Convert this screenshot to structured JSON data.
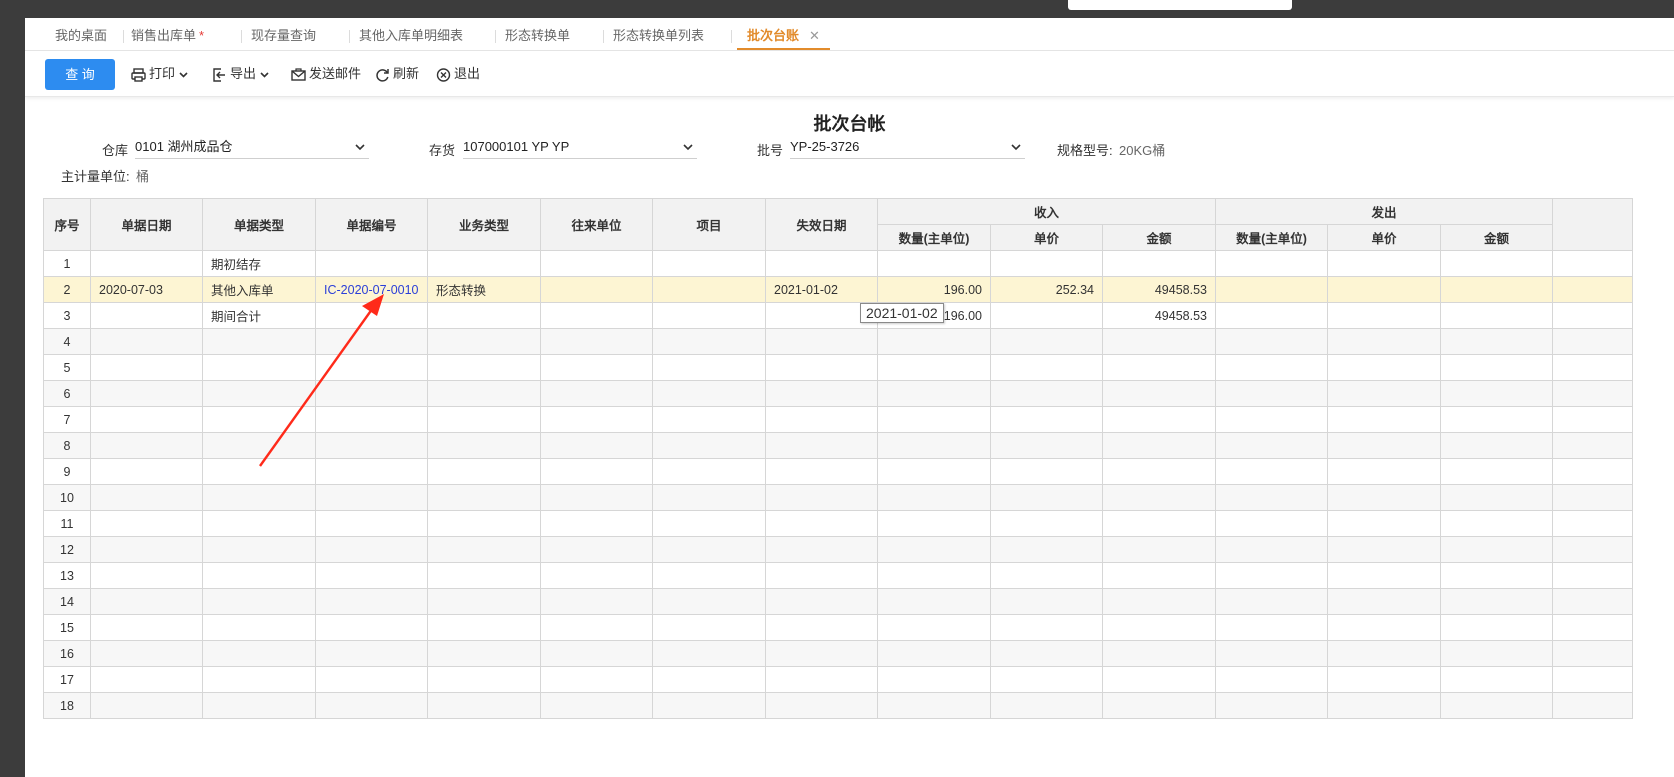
{
  "tabs": [
    {
      "label": "我的桌面"
    },
    {
      "label": "销售出库单",
      "star": "*"
    },
    {
      "label": "现存量查询"
    },
    {
      "label": "其他入库单明细表"
    },
    {
      "label": "形态转换单"
    },
    {
      "label": "形态转换单列表"
    },
    {
      "label": "批次台账",
      "close": "✕"
    }
  ],
  "toolbar": {
    "query": "查 询",
    "print": "打印",
    "export": "导出",
    "email": "发送邮件",
    "refresh": "刷新",
    "exit": "退出"
  },
  "page_title": "批次台帐",
  "filters": {
    "warehouse_label": "仓库",
    "warehouse_value": "0101 湖州成品仓",
    "inventory_label": "存货",
    "inventory_value": "107000101 YP YP",
    "batch_label": "批号",
    "batch_value": "YP-25-3726",
    "spec_label": "规格型号:",
    "spec_value": "20KG桶",
    "unit_label": "主计量单位:",
    "unit_value": "桶"
  },
  "table": {
    "headers": {
      "seq": "序号",
      "date": "单据日期",
      "type": "单据类型",
      "no": "单据编号",
      "biz": "业务类型",
      "partner": "往来单位",
      "project": "项目",
      "expiry": "失效日期",
      "income": "收入",
      "outgo": "发出"
    },
    "sub_headers": [
      "数量(主单位)",
      "单价",
      "金额"
    ],
    "rows": [
      {
        "seq": "1",
        "date": "",
        "type": "期初结存",
        "no": "",
        "biz": "",
        "partner": "",
        "project": "",
        "expiry": "",
        "in_qty": "",
        "in_price": "",
        "in_amt": "",
        "out_qty": "",
        "out_price": "",
        "out_amt": ""
      },
      {
        "seq": "2",
        "date": "2020-07-03",
        "type": "其他入库单",
        "no": "IC-2020-07-0010",
        "biz": "形态转换",
        "partner": "",
        "project": "",
        "expiry": "2021-01-02",
        "in_qty": "196.00",
        "in_price": "252.34",
        "in_amt": "49458.53",
        "out_qty": "",
        "out_price": "",
        "out_amt": ""
      },
      {
        "seq": "3",
        "date": "",
        "type": "期间合计",
        "no": "",
        "biz": "",
        "partner": "",
        "project": "",
        "expiry": "",
        "in_qty": "196.00",
        "in_price": "",
        "in_amt": "49458.53",
        "out_qty": "",
        "out_price": "",
        "out_amt": ""
      },
      {
        "seq": "4"
      },
      {
        "seq": "5"
      },
      {
        "seq": "6"
      },
      {
        "seq": "7"
      },
      {
        "seq": "8"
      },
      {
        "seq": "9"
      },
      {
        "seq": "10"
      },
      {
        "seq": "11"
      },
      {
        "seq": "12"
      },
      {
        "seq": "13"
      },
      {
        "seq": "14"
      },
      {
        "seq": "15"
      },
      {
        "seq": "16"
      },
      {
        "seq": "17"
      },
      {
        "seq": "18"
      }
    ]
  },
  "tooltip": "2021-01-02",
  "colors": {
    "accent": "#2d8cf0",
    "active_tab": "#e28b2b",
    "highlight_row": "#fdf5d3",
    "link": "#2b3fd8",
    "arrow": "#ff2a1a"
  }
}
